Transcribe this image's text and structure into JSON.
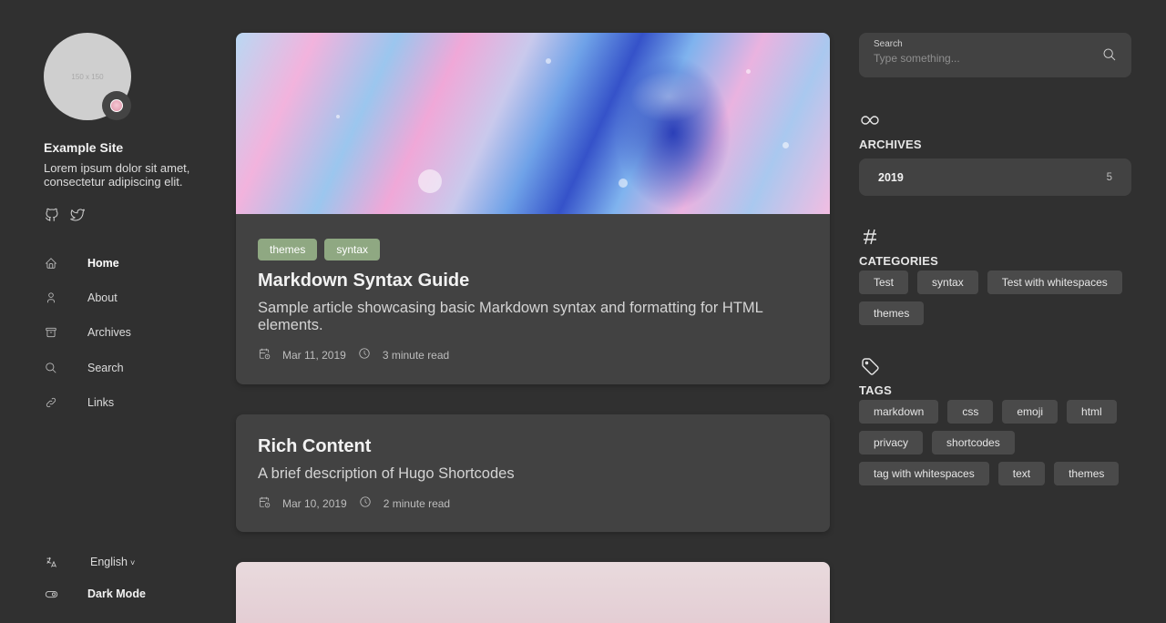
{
  "sidebar": {
    "avatar_placeholder": "150 x 150",
    "site_name": "Example Site",
    "site_description": "Lorem ipsum dolor sit amet, consectetur adipiscing elit.",
    "social": [
      {
        "icon": "github-icon"
      },
      {
        "icon": "twitter-icon"
      }
    ],
    "menu": [
      {
        "label": "Home",
        "icon": "home-icon",
        "current": true
      },
      {
        "label": "About",
        "icon": "user-icon",
        "current": false
      },
      {
        "label": "Archives",
        "icon": "archive-icon",
        "current": false
      },
      {
        "label": "Search",
        "icon": "search-icon",
        "current": false
      },
      {
        "label": "Links",
        "icon": "link-icon",
        "current": false
      }
    ],
    "language": {
      "selected": "English",
      "icon": "language-icon"
    },
    "dark_mode": {
      "label": "Dark Mode",
      "icon": "toggle-icon"
    }
  },
  "articles": [
    {
      "has_image": true,
      "categories": [
        "themes",
        "syntax"
      ],
      "title": "Markdown Syntax Guide",
      "subtitle": "Sample article showcasing basic Markdown syntax and formatting for HTML elements.",
      "date": "Mar 11, 2019",
      "read_time": "3 minute read"
    },
    {
      "has_image": false,
      "categories": [],
      "title": "Rich Content",
      "subtitle": "A brief description of Hugo Shortcodes",
      "date": "Mar 10, 2019",
      "read_time": "2 minute read"
    }
  ],
  "search": {
    "label": "Search",
    "placeholder": "Type something..."
  },
  "archives": {
    "heading": "ARCHIVES",
    "icon": "infinity-icon",
    "items": [
      {
        "year": "2019",
        "count": "5"
      }
    ]
  },
  "categories": {
    "heading": "CATEGORIES",
    "icon": "hash-icon",
    "items": [
      "Test",
      "syntax",
      "Test with whitespaces",
      "themes"
    ]
  },
  "tags": {
    "heading": "TAGS",
    "icon": "tag-icon",
    "items": [
      "markdown",
      "css",
      "emoji",
      "html",
      "privacy",
      "shortcodes",
      "tag with whitespaces",
      "text",
      "themes"
    ]
  },
  "colors": {
    "background": "#303030",
    "card": "#424242",
    "category_chip": "#8fa882",
    "chip": "#4a4a4a"
  }
}
